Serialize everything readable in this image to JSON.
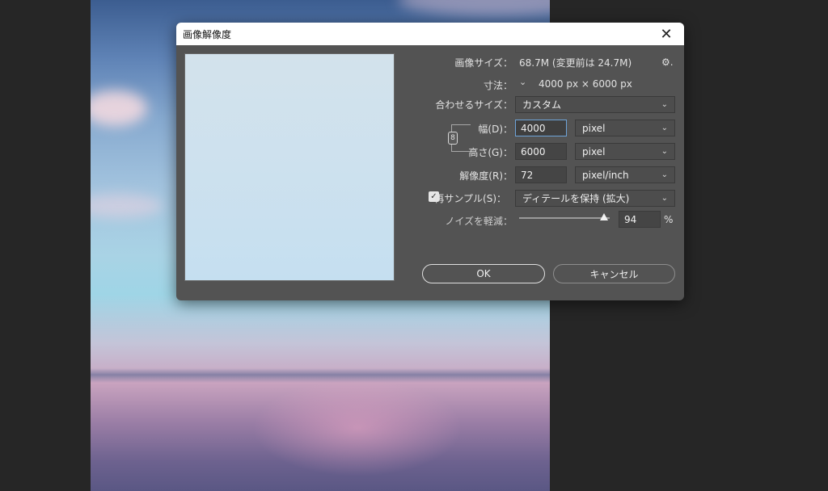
{
  "dialog": {
    "title": "画像解像度",
    "close_glyph": "✕"
  },
  "info": {
    "image_size_label": "画像サイズ：",
    "image_size_value": "68.7M (変更前は 24.7M)",
    "dimensions_label": "寸法：",
    "dimensions_value": "4000 px × 6000 px",
    "gear_glyph": "⚙."
  },
  "fit_to": {
    "label": "合わせるサイズ：",
    "value": "カスタム"
  },
  "width": {
    "label": "幅(D)：",
    "value": "4000",
    "unit": "pixel"
  },
  "height": {
    "label": "高さ(G)：",
    "value": "6000",
    "unit": "pixel"
  },
  "resolution": {
    "label": "解像度(R)：",
    "value": "72",
    "unit": "pixel/inch"
  },
  "resample": {
    "label": "再サンプル(S)：",
    "checked": true,
    "method": "ディテールを保持 (拡大)"
  },
  "noise": {
    "label": "ノイズを軽減：",
    "value": "94",
    "unit": "%",
    "level_percent": 94
  },
  "buttons": {
    "ok": "OK",
    "cancel": "キャンセル"
  },
  "glyphs": {
    "chevron": "⌄",
    "check": "✓",
    "link": "8"
  }
}
